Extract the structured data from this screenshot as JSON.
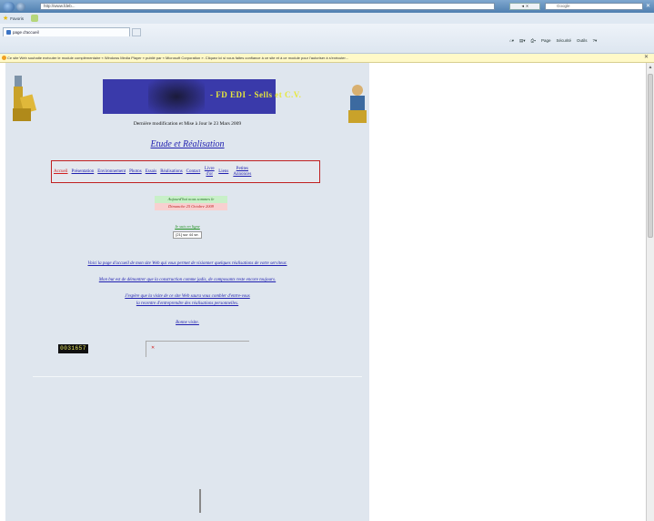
{
  "browser": {
    "address_text": "http://www.fdeb...",
    "address_right_text": "◄ ✕",
    "search_placeholder": "Google",
    "favorites_label": "Favoris",
    "tab_title": "page d'accueil",
    "command_bar": [
      "Page",
      "Sécurité",
      "Outils"
    ],
    "info_bar_text": "Ce site Web souhaite exécuter le module complémentaire « Windows Media Player » publié par « Microsoft Corporation ». Cliquez ici si vous faites confiance à ce site et à ce module pour l'autoriser à s'exécuter..."
  },
  "page": {
    "banner_text": "- FD EDI - Sells et C.V.",
    "update_line": "Dernière modification et Mise à Jour le 23 Mars 2009",
    "subtitle": "Etude et Réalisation",
    "nav": [
      {
        "label": "Accueil",
        "active": true
      },
      {
        "label": "Présentation",
        "active": false
      },
      {
        "label": "Environnement",
        "active": false
      },
      {
        "label": "Photos",
        "active": false
      },
      {
        "label": "Essais",
        "active": false
      },
      {
        "label": "Réalisations",
        "active": false
      },
      {
        "label": "Contact",
        "active": false
      },
      {
        "label": "Livre d'or",
        "active": false
      },
      {
        "label": "Liens",
        "active": false
      },
      {
        "label": "Petites Annonces",
        "active": false
      }
    ],
    "date_line1": "Aujourd'hui nous sommes le",
    "date_line2": "Dimanche 25 Octobre 2009",
    "online_label": "Je suis en ligne",
    "online_count": "[21] sur 44 se.",
    "paragraph1": "Voici la page d'accueil de mon site Web qui vous permet de visionner quelques réalisations de votre serviteur.",
    "paragraph2": "Mon but est de démontrer que la construction comme jadis, de composants reste encore toujours.",
    "paragraph3a": "J'espère que la visite de ce site Web saura vous combler d'entre-vous",
    "paragraph3b": "la recentre d'entreprendre des réalisations personnelles.",
    "farewell": "Bonne visite.",
    "visit_counter": "0031657",
    "counter_mark": "✕"
  }
}
